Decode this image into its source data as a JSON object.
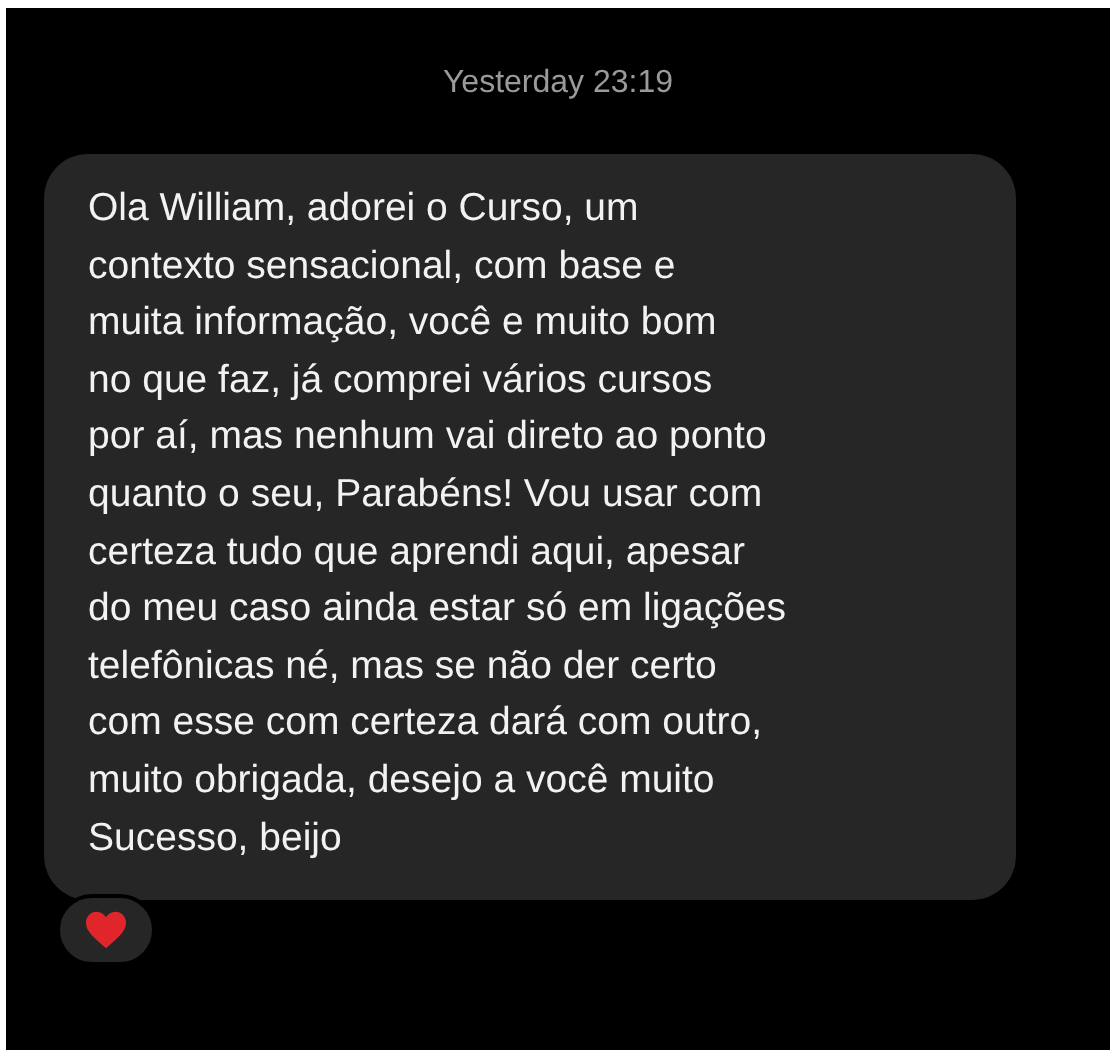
{
  "timestamp": "Yesterday 23:19",
  "message": {
    "lines": [
      "Ola William, adorei o Curso, um",
      "contexto sensacional, com base e",
      "muita informação, você e muito bom",
      "no que faz, já comprei vários cursos",
      "por aí, mas nenhum vai direto ao ponto",
      "quanto o seu, Parabéns! Vou usar com",
      "certeza tudo que aprendi aqui, apesar",
      "do meu caso ainda estar só em ligações",
      "telefônicas né, mas se não der certo",
      "com esse com certeza dará com outro,",
      "muito obrigada, desejo a você muito",
      "Sucesso, beijo"
    ]
  }
}
